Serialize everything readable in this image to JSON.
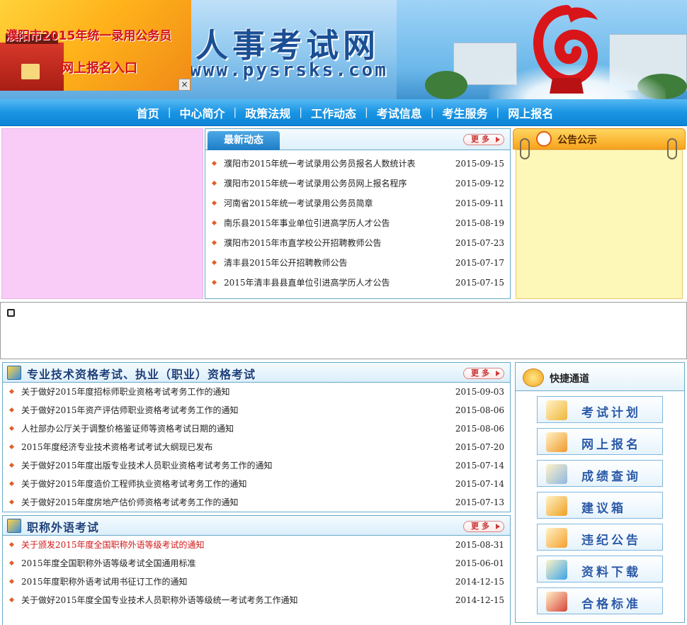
{
  "banner": {
    "title": "人事考试网",
    "url": "www.pysrsks.com"
  },
  "ad": {
    "line1": "濮阳市2015年统一录用公务员",
    "line2": "网上报名入口",
    "close": "×"
  },
  "nav": {
    "items": [
      "首页",
      "中心简介",
      "政策法规",
      "工作动态",
      "考试信息",
      "考生服务",
      "网上报名"
    ],
    "separator": "|"
  },
  "latest": {
    "title": "最新动态",
    "more": "更多",
    "items": [
      {
        "title": "濮阳市2015年统一考试录用公务员报名人数统计表",
        "date": "2015-09-15"
      },
      {
        "title": "濮阳市2015年统一考试录用公务员网上报名程序",
        "date": "2015-09-12"
      },
      {
        "title": "河南省2015年统一考试录用公务员简章",
        "date": "2015-09-11"
      },
      {
        "title": "南乐县2015年事业单位引进高学历人才公告",
        "date": "2015-08-19"
      },
      {
        "title": "濮阳市2015年市直学校公开招聘教师公告",
        "date": "2015-07-23"
      },
      {
        "title": "清丰县2015年公开招聘教师公告",
        "date": "2015-07-17"
      },
      {
        "title": "2015年清丰县县直单位引进高学历人才公告",
        "date": "2015-07-15"
      }
    ]
  },
  "notice": {
    "title": "公告公示"
  },
  "professional": {
    "title": "专业技术资格考试、执业（职业）资格考试",
    "more": "更多",
    "items": [
      {
        "title": "关于做好2015年度招标师职业资格考试考务工作的通知",
        "date": "2015-09-03"
      },
      {
        "title": "关于做好2015年资产评估师职业资格考试考务工作的通知",
        "date": "2015-08-06"
      },
      {
        "title": "人社部办公厅关于调整价格鉴证师等资格考试日期的通知",
        "date": "2015-08-06"
      },
      {
        "title": "2015年度经济专业技术资格考试考试大纲现已发布",
        "date": "2015-07-20"
      },
      {
        "title": "关于做好2015年度出版专业技术人员职业资格考试考务工作的通知",
        "date": "2015-07-14"
      },
      {
        "title": "关于做好2015年度造价工程师执业资格考试考务工作的通知",
        "date": "2015-07-14"
      },
      {
        "title": "关于做好2015年度房地产估价师资格考试考务工作的通知",
        "date": "2015-07-13"
      }
    ]
  },
  "language": {
    "title": "职称外语考试",
    "more": "更多",
    "items": [
      {
        "title": "关于颁发2015年度全国职称外语等级考试的通知",
        "date": "2015-08-31",
        "highlight": true
      },
      {
        "title": "2015年度全国职称外语等级考试全国通用标准",
        "date": "2015-06-01"
      },
      {
        "title": "2015年度职称外语考试用书征订工作的通知",
        "date": "2014-12-15"
      },
      {
        "title": "关于做好2015年度全国专业技术人员职称外语等级统一考试考务工作通知",
        "date": "2014-12-15"
      }
    ]
  },
  "quick": {
    "title": "快捷通道",
    "buttons": [
      {
        "label": "考试计划",
        "icon": "pencil-check-icon",
        "color": "#f0b63a"
      },
      {
        "label": "网上报名",
        "icon": "computer-icon",
        "color": "#f09a2a"
      },
      {
        "label": "成绩查询",
        "icon": "magnifier-icon",
        "color": "#8fb8e0"
      },
      {
        "label": "建议箱",
        "icon": "mailbox-icon",
        "color": "#f0a020"
      },
      {
        "label": "违纪公告",
        "icon": "notice-board-icon",
        "color": "#f5a02a"
      },
      {
        "label": "资料下载",
        "icon": "download-icon",
        "color": "#3aa5e8"
      },
      {
        "label": "合格标准",
        "icon": "books-icon",
        "color": "#d8443a"
      }
    ]
  }
}
